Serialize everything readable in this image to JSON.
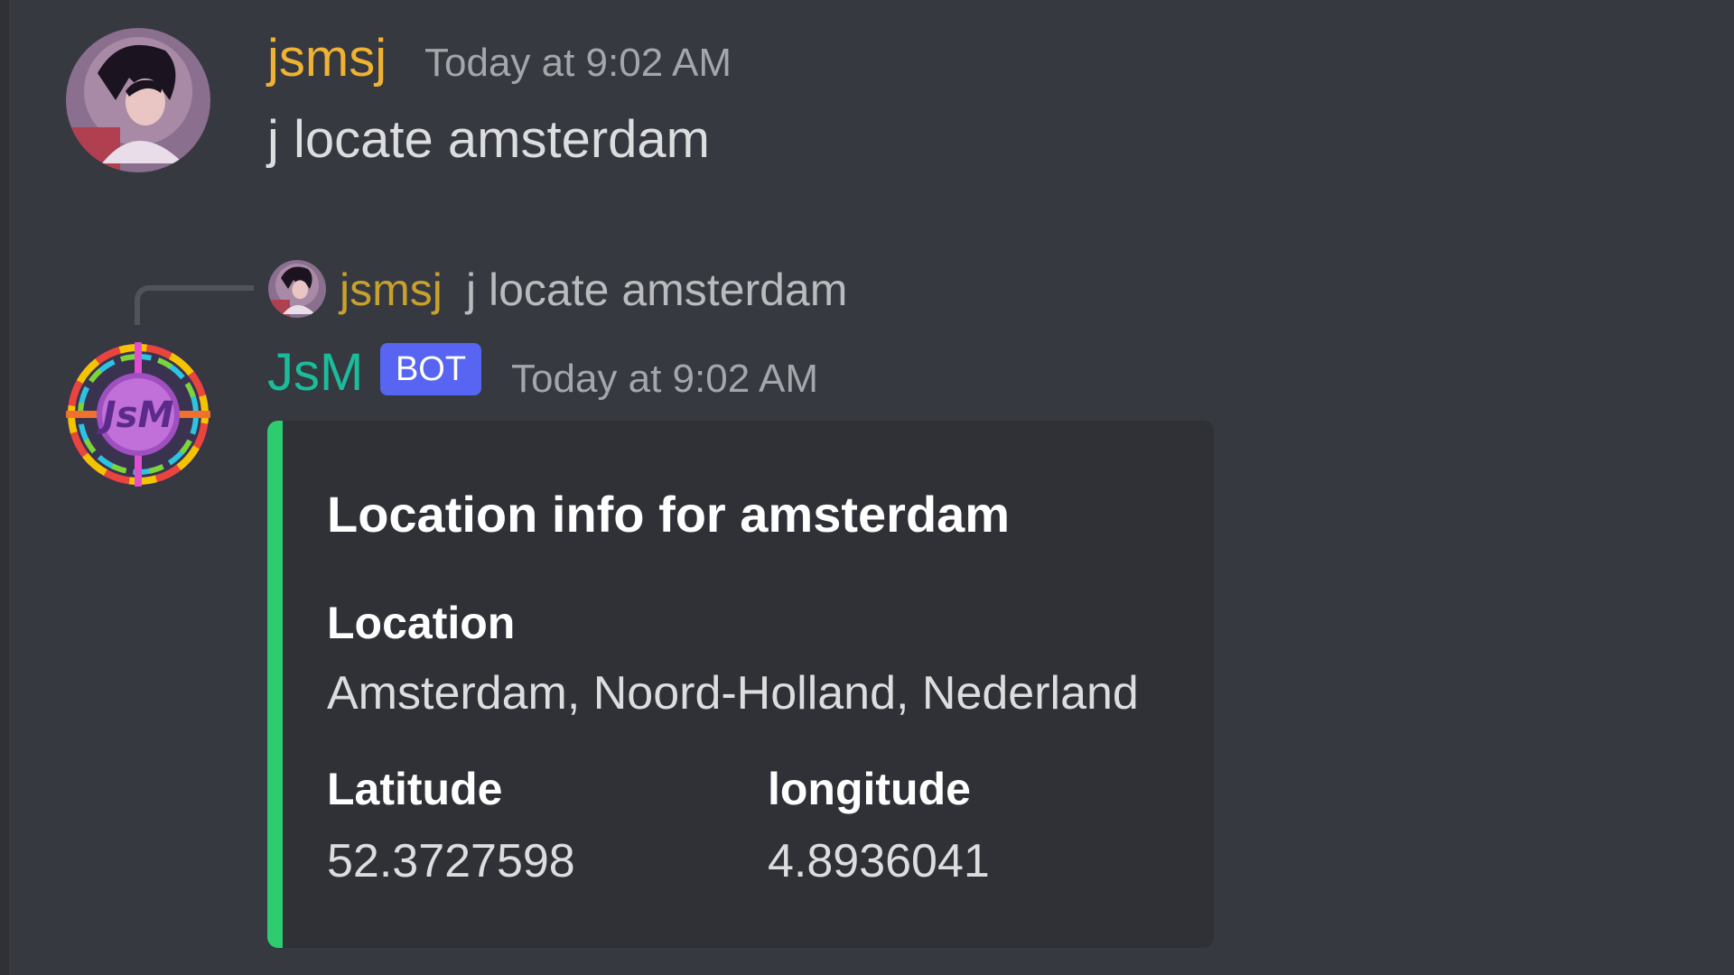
{
  "colors": {
    "background": "#36393f",
    "user_name_color": "#f0b232",
    "bot_name_color": "#1abc9c",
    "bot_badge_color": "#5865f2",
    "embed_accent": "#2ecc71",
    "embed_background": "#2f3136"
  },
  "messages": {
    "user_message": {
      "avatar_icon": "user-avatar-anime-portrait",
      "username": "jsmsj",
      "timestamp": "Today at 9:02 AM",
      "content": "j locate amsterdam"
    },
    "bot_message": {
      "reply": {
        "avatar_icon": "user-avatar-anime-portrait",
        "username": "jsmsj",
        "content": "j locate amsterdam"
      },
      "avatar_icon": "jsm-bot-logo",
      "username": "JsM",
      "badge": "BOT",
      "timestamp": "Today at 9:02 AM",
      "embed": {
        "title": "Location info for amsterdam",
        "fields": [
          {
            "name": "Location",
            "value": "Amsterdam, Noord-Holland, Nederland"
          },
          {
            "name": "Latitude",
            "value": "52.3727598"
          },
          {
            "name": "longitude",
            "value": "4.8936041"
          }
        ]
      }
    }
  }
}
